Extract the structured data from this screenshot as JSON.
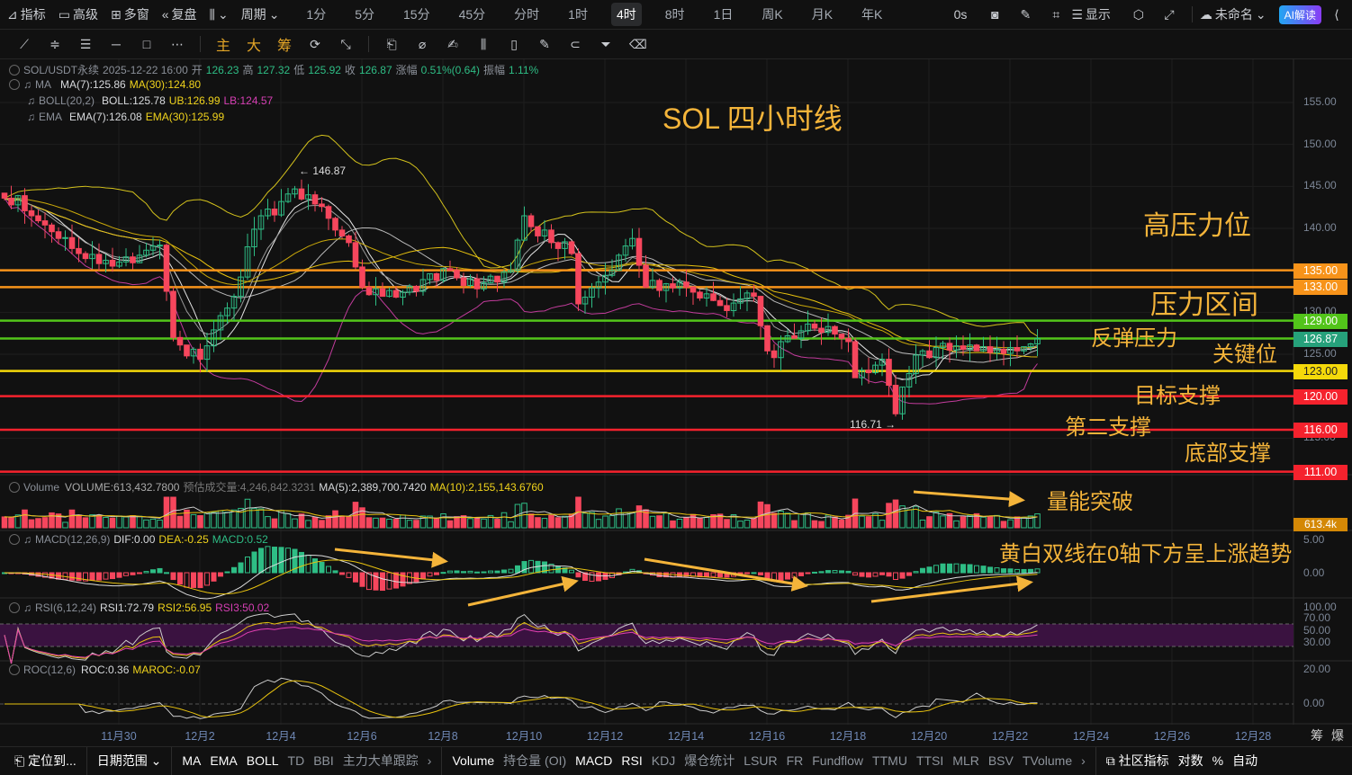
{
  "toolbar": {
    "left": [
      {
        "icon": "chart-line-icon",
        "label": "指标"
      },
      {
        "icon": "window-icon",
        "label": "高级"
      },
      {
        "icon": "grid-icon",
        "label": "多窗"
      },
      {
        "icon": "rewind-icon",
        "label": "复盘"
      }
    ],
    "chart_type_icon": "candlestick-icon",
    "period_label": "周期",
    "timeframes": [
      "1分",
      "5分",
      "15分",
      "45分",
      "分时",
      "1时",
      "4时",
      "8时",
      "1日",
      "周K",
      "月K",
      "年K"
    ],
    "active_timeframe": "4时",
    "countdown": "0s",
    "display_label": "显示",
    "layout_name": "未命名",
    "ai_label": "AI解读"
  },
  "drawing_tools": {
    "text_tools": [
      "主",
      "大",
      "筹"
    ]
  },
  "info": {
    "symbol": "SOL/USDT永续",
    "datetime": "2025-12-22 16:00",
    "open_label": "开",
    "open": "126.23",
    "high_label": "高",
    "high": "127.32",
    "low_label": "低",
    "low": "125.92",
    "close_label": "收",
    "close": "126.87",
    "change_label": "涨幅",
    "change": "0.51%(0.64)",
    "amp_label": "振幅",
    "amp": "1.11%",
    "ma": {
      "name": "MA",
      "ma7": "MA(7):125.86",
      "ma30": "MA(30):124.80"
    },
    "boll": {
      "name": "BOLL(20,2)",
      "mid": "BOLL:125.78",
      "ub": "UB:126.99",
      "lb": "LB:124.57"
    },
    "ema": {
      "name": "EMA",
      "ema7": "EMA(7):126.08",
      "ema30": "EMA(30):125.99"
    }
  },
  "chart_title": "SOL 四小时线",
  "annotations": {
    "high_pressure": "高压力位",
    "pressure_zone": "压力区间",
    "rebound_pressure": "反弹压力",
    "key_level": "关键位",
    "target_support": "目标支撑",
    "second_support": "第二支撑",
    "bottom_support": "底部支撑",
    "volume_break": "量能突破",
    "macd_note": "黄白双线在0轴下方呈上涨趋势"
  },
  "price_axis": [
    "155.00",
    "150.00",
    "145.00",
    "140.00",
    "130.00",
    "125.00",
    "120.00",
    "115.00"
  ],
  "levels": [
    {
      "price": 135,
      "label": "135.00",
      "color": "#f7931a"
    },
    {
      "price": 133,
      "label": "133.00",
      "color": "#f7931a"
    },
    {
      "price": 129,
      "label": "129.00",
      "color": "#52c41a"
    },
    {
      "price": 126.87,
      "label": "126.87",
      "color": "#52c41a",
      "label_color": "#26a17b"
    },
    {
      "price": 123,
      "label": "123.00",
      "color": "#f5d90a",
      "text_color": "#222"
    },
    {
      "price": 120,
      "label": "120.00",
      "color": "#f5222d"
    },
    {
      "price": 116,
      "label": "116.00",
      "color": "#f5222d"
    },
    {
      "price": 111,
      "label": "111.00",
      "color": "#f5222d"
    }
  ],
  "marks": {
    "high": "← 146.87",
    "low": "116.71 →"
  },
  "volume": {
    "name": "Volume",
    "value": "VOLUME:613,432.7800",
    "est": "预估成交量:4,246,842.3231",
    "ma5": "MA(5):2,389,700.7420",
    "ma10": "MA(10):2,155,143.6760",
    "last": "613.4k"
  },
  "macd": {
    "name": "MACD(12,26,9)",
    "dif": "DIF:0.00",
    "dea": "DEA:-0.25",
    "macd": "MACD:0.52",
    "axis": [
      "5.00",
      "0.00"
    ]
  },
  "rsi": {
    "name": "RSI(6,12,24)",
    "rsi1": "RSI1:72.79",
    "rsi2": "RSI2:56.95",
    "rsi3": "RSI3:50.02",
    "axis": [
      "100.00",
      "70.00",
      "50.00",
      "30.00"
    ]
  },
  "roc": {
    "name": "ROC(12,6)",
    "roc": "ROC:0.36",
    "maroc": "MAROC:-0.07",
    "axis": [
      "20.00",
      "0.00"
    ]
  },
  "dates": [
    "11月30",
    "12月2",
    "12月4",
    "12月6",
    "12月8",
    "12月10",
    "12月12",
    "12月14",
    "12月16",
    "12月18",
    "12月20",
    "12月22",
    "12月24",
    "12月26",
    "12月28"
  ],
  "axis_corner": [
    "筹",
    "爆"
  ],
  "bottom": {
    "locate": "定位到...",
    "range": "日期范围",
    "main_indicators": [
      {
        "l": "MA",
        "on": true
      },
      {
        "l": "EMA",
        "on": true
      },
      {
        "l": "BOLL",
        "on": true
      },
      {
        "l": "TD"
      },
      {
        "l": "BBI"
      },
      {
        "l": "主力大单跟踪"
      }
    ],
    "sub_indicators": [
      {
        "l": "Volume",
        "on": true
      },
      {
        "l": "持仓量 (OI)"
      },
      {
        "l": "MACD",
        "on": true
      },
      {
        "l": "RSI",
        "on": true
      },
      {
        "l": "KDJ"
      },
      {
        "l": "爆仓统计"
      },
      {
        "l": "LSUR"
      },
      {
        "l": "FR"
      },
      {
        "l": "Fundflow"
      },
      {
        "l": "TTMU"
      },
      {
        "l": "TTSI"
      },
      {
        "l": "MLR"
      },
      {
        "l": "BSV"
      },
      {
        "l": "TVolume"
      }
    ],
    "community": "社区指标",
    "log": "对数",
    "pct": "%",
    "auto": "自动"
  },
  "colors": {
    "up": "#2ebd85",
    "down": "#f6465d",
    "annotation": "#f4b43a",
    "rsi_band": "#3a1240"
  },
  "chart_data": {
    "type": "candlestick",
    "interval": "4h",
    "last_candle": "2025-12-22 16:00",
    "closes": [
      143.6,
      142.8,
      143.9,
      142.1,
      141.5,
      140.9,
      140.4,
      139.6,
      138.8,
      138.9,
      137.6,
      137.0,
      136.4,
      136.9,
      135.8,
      136.2,
      135.5,
      136.0,
      136.6,
      135.9,
      136.8,
      137.4,
      137.9,
      138.0,
      132.5,
      127.0,
      126.1,
      124.8,
      125.6,
      124.4,
      126.0,
      127.9,
      129.6,
      130.5,
      131.9,
      134.2,
      137.8,
      139.9,
      141.5,
      142.3,
      141.6,
      143.2,
      144.1,
      144.7,
      143.5,
      144.0,
      142.9,
      142.6,
      141.2,
      139.8,
      139.1,
      138.3,
      135.4,
      133.0,
      132.1,
      132.8,
      131.9,
      132.6,
      131.8,
      132.4,
      133.1,
      132.5,
      133.9,
      134.6,
      133.8,
      135.2,
      135.0,
      134.1,
      133.2,
      134.0,
      132.8,
      133.5,
      134.3,
      133.6,
      134.8,
      135.0,
      138.6,
      141.5,
      140.2,
      139.1,
      139.8,
      138.3,
      137.6,
      138.4,
      137.0,
      131.0,
      131.8,
      132.9,
      133.6,
      134.4,
      135.0,
      136.8,
      137.9,
      138.8,
      135.6,
      133.0,
      133.8,
      132.6,
      133.4,
      132.9,
      133.6,
      133.0,
      132.4,
      131.7,
      132.2,
      131.4,
      130.8,
      130.2,
      131.1,
      131.6,
      132.3,
      131.9,
      128.4,
      125.4,
      124.6,
      126.5,
      127.2,
      126.9,
      127.8,
      128.6,
      128.1,
      127.6,
      128.3,
      127.4,
      126.9,
      126.5,
      122.2,
      123.1,
      122.8,
      123.7,
      124.4,
      121.3,
      117.9,
      121.1,
      122.7,
      124.9,
      125.4,
      124.6,
      125.8,
      126.3,
      125.5,
      126.0,
      125.6,
      126.1,
      125.4,
      125.9,
      125.2,
      125.6,
      125.1,
      125.8,
      125.4,
      125.9,
      126.23,
      126.87
    ],
    "period_high": 146.87,
    "period_low": 116.71,
    "price_range": [
      109,
      157
    ]
  }
}
